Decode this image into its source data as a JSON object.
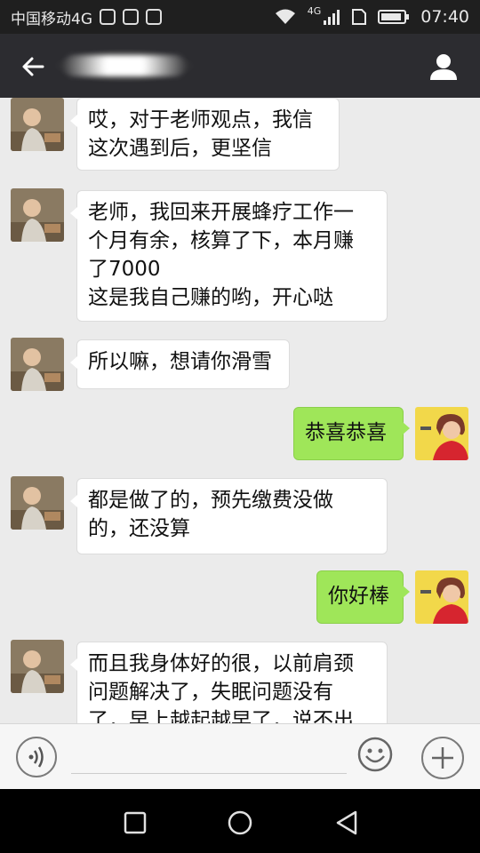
{
  "status_bar": {
    "carrier": "中国移动4G",
    "network_badge": "4G",
    "time": "07:40"
  },
  "header": {
    "title": "",
    "icons": [
      "back-arrow-icon",
      "person-icon"
    ]
  },
  "messages": [
    {
      "side": "left",
      "text": "哎，对于老师观点，我信\n这次遇到后，更坚信"
    },
    {
      "side": "left",
      "text": "老师，我回来开展蜂疗工作一\n个月有余，核算了下，本月赚\n了7000\n这是我自己赚的哟，开心哒"
    },
    {
      "side": "left",
      "text": "所以嘛，想请你滑雪"
    },
    {
      "side": "right",
      "text": "恭喜恭喜"
    },
    {
      "side": "left",
      "text": "都是做了的，预先缴费没做\n的，还没算"
    },
    {
      "side": "right",
      "text": "你好棒"
    },
    {
      "side": "left",
      "text": "而且我身体好的很，以前肩颈\n问题解决了，失眠问题没有\n了，早上越起越早了，说不出"
    }
  ],
  "input_bar": {
    "placeholder": "",
    "icons": [
      "voice-icon",
      "emoji-icon",
      "plus-icon"
    ]
  },
  "nav_bar": {
    "icons": [
      "recent-apps-icon",
      "home-icon",
      "back-icon"
    ]
  },
  "colors": {
    "header_bg": "#2c2c30",
    "chat_bg": "#ebebeb",
    "bubble_left": "#ffffff",
    "bubble_right": "#9fe659"
  }
}
